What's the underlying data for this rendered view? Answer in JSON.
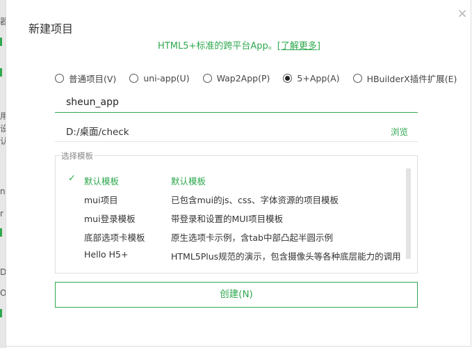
{
  "background": {
    "glyphs": [
      "器",
      "用",
      "设",
      "认",
      "n",
      "r",
      "D",
      "O"
    ]
  },
  "dialog": {
    "title": "新建项目",
    "close_icon": "×",
    "subtitle_text": "HTML5+标准的跨平台App。",
    "subtitle_link": "[了解更多]"
  },
  "project_types": [
    {
      "label": "普通项目(V)",
      "selected": false
    },
    {
      "label": "uni-app(U)",
      "selected": false
    },
    {
      "label": "Wap2App(P)",
      "selected": false
    },
    {
      "label": "5+App(A)",
      "selected": true
    },
    {
      "label": "HBuilderX插件扩展(E)",
      "selected": false
    }
  ],
  "project_name": {
    "value": "sheun_app"
  },
  "location": {
    "path": "D:/桌面/check",
    "browse_label": "浏览"
  },
  "templates": {
    "legend": "选择模板",
    "rows": [
      {
        "name": "默认模板",
        "desc": "默认模板",
        "selected": true,
        "check": "✓"
      },
      {
        "name": "mui项目",
        "desc": "已包含mui的js、css、字体资源的项目模板",
        "selected": false,
        "check": ""
      },
      {
        "name": "mui登录模板",
        "desc": "带登录和设置的MUI项目模板",
        "selected": false,
        "check": ""
      },
      {
        "name": "底部选项卡模板",
        "desc": "原生选项卡示例，含tab中部凸起半圆示例",
        "selected": false,
        "check": ""
      },
      {
        "name": "Hello H5+",
        "desc": "HTML5Plus规范的演示，包含摄像头等各种底层能力的调用",
        "selected": false,
        "check": ""
      }
    ]
  },
  "create_button": {
    "label": "创建(N)"
  },
  "colors": {
    "accent": "#2fa84f",
    "border": "#dedede",
    "text": "#333333"
  }
}
